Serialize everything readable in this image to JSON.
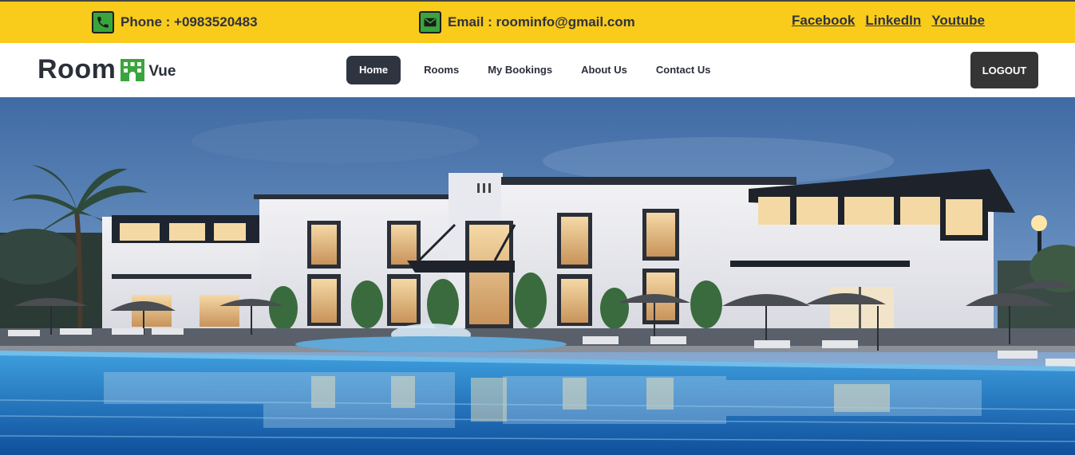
{
  "topbar": {
    "phone": "Phone : +0983520483",
    "email": "Email : roominfo@gmail.com",
    "social": [
      "Facebook",
      "LinkedIn",
      "Youtube"
    ]
  },
  "brand": {
    "main": "Room",
    "sub": "Vue"
  },
  "nav": [
    "Home",
    "Rooms",
    "My Bookings",
    "About Us",
    "Contact Us"
  ],
  "logout_label": "LOGOUT",
  "colors": {
    "topbar_bg": "#f9cb1b",
    "icon_green": "#3aa53d",
    "nav_active": "#2e3440",
    "logout_bg": "#353535"
  },
  "hero": {
    "icon": "resort-pool-hero-image"
  }
}
